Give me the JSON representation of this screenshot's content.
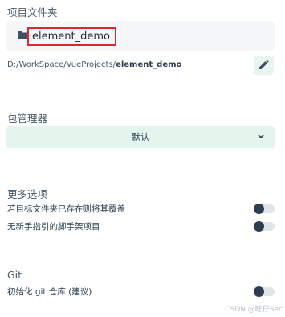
{
  "project_folder": {
    "title": "项目文件夹",
    "folder_name": "element_demo",
    "path_prefix": "D:/WorkSpace/VueProjects/",
    "path_name": "element_demo"
  },
  "package_manager": {
    "title": "包管理器",
    "selected": "默认"
  },
  "more_options": {
    "title": "更多选项",
    "items": [
      {
        "label": "若目标文件夹已存在则将其覆盖",
        "enabled": false
      },
      {
        "label": "无新手指引的脚手架项目",
        "enabled": false
      }
    ]
  },
  "git": {
    "title": "Git",
    "items": [
      {
        "label": "初始化 git 仓库 (建议)",
        "enabled": false
      }
    ]
  },
  "watermark": "CSDN @旺仔Sec",
  "colors": {
    "accent_bg": "#e3f5ec",
    "highlight_border": "#e0272b",
    "toggle_knob": "#2c3e50"
  }
}
